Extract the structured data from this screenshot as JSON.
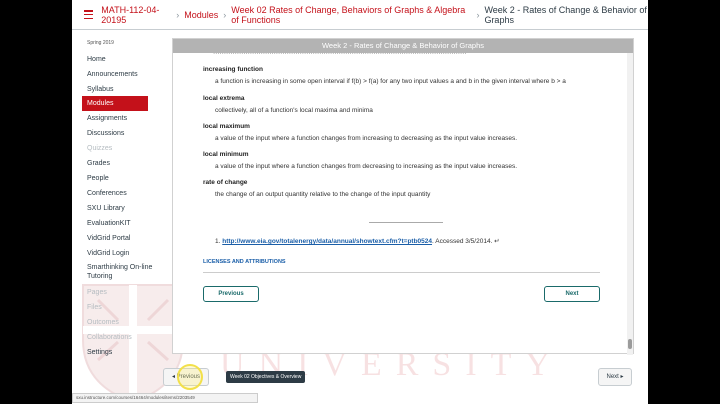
{
  "breadcrumb": {
    "course": "MATH-112-04-20195",
    "modules": "Modules",
    "week_module": "Week 02 Rates of Change, Behaviors of Graphs & Algebra of Functions",
    "page": "Week 2 - Rates of Change & Behavior of Graphs"
  },
  "nav": {
    "term": "Spring 2019",
    "items": [
      {
        "label": "Home"
      },
      {
        "label": "Announcements"
      },
      {
        "label": "Syllabus"
      },
      {
        "label": "Modules"
      },
      {
        "label": "Assignments"
      },
      {
        "label": "Discussions"
      },
      {
        "label": "Quizzes"
      },
      {
        "label": "Grades"
      },
      {
        "label": "People"
      },
      {
        "label": "Conferences"
      },
      {
        "label": "SXU Library"
      },
      {
        "label": "EvaluationKIT"
      },
      {
        "label": "VidGrid Portal"
      },
      {
        "label": "VidGrid Login"
      },
      {
        "label": "Smarthinking On-line Tutoring"
      },
      {
        "label": "Pages"
      },
      {
        "label": "Files"
      },
      {
        "label": "Outcomes"
      },
      {
        "label": "Collaborations"
      },
      {
        "label": "Settings"
      }
    ]
  },
  "watermark": "UNIVERSITY",
  "content": {
    "window_title": "Week 2 - Rates of Change & Behavior of Graphs",
    "terms": [
      {
        "title": "increasing function",
        "definition": "a function is increasing in some open interval if f(b) > f(a) for any two input values a and b in the given interval where b > a"
      },
      {
        "title": "local extrema",
        "definition": "collectively, all of a function's local maxima and minima"
      },
      {
        "title": "local maximum",
        "definition": "a value of the input where a function changes from increasing to decreasing as the input value increases."
      },
      {
        "title": "local minimum",
        "definition": "a value of the input where a function changes from decreasing to increasing as the input value increases."
      },
      {
        "title": "rate of change",
        "definition": "the change of an output quantity relative to the change of the input quantity"
      }
    ],
    "footnote_num": "1.",
    "footnote_link": "http://www.eia.gov/totalenergy/data/annual/showtext.cfm?t=ptb0524",
    "footnote_rest": ". Accessed 3/5/2014. ↵",
    "licenses": "LICENSES AND ATTRIBUTIONS",
    "prev_label": "Previous",
    "next_label": "Next"
  },
  "bottom": {
    "prev_label": "◂ Previous",
    "tooltip": "Week 02 Objectives & Overview",
    "next_label": "Next ▸",
    "status_url": "sxu.instructure.com/courses/16464/modules/items/2203549"
  }
}
